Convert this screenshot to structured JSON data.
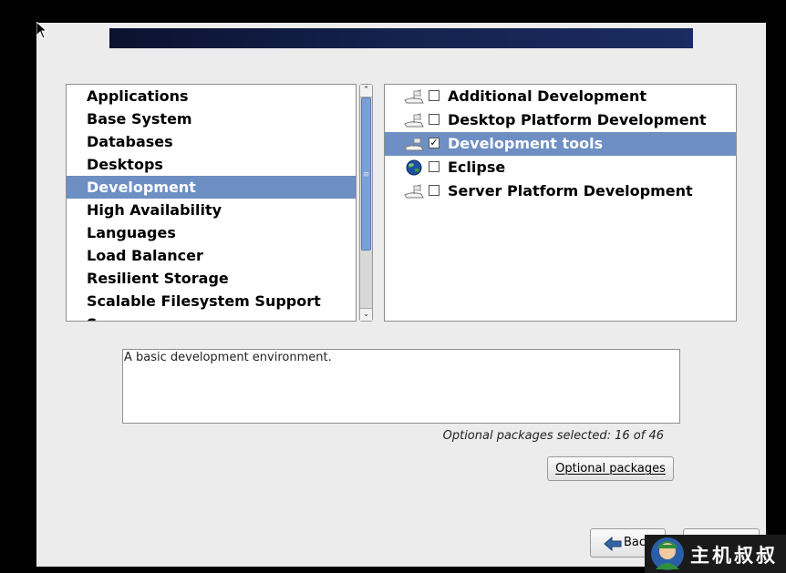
{
  "categories": {
    "items": [
      {
        "label": "Applications",
        "selected": false
      },
      {
        "label": "Base System",
        "selected": false
      },
      {
        "label": "Databases",
        "selected": false
      },
      {
        "label": "Desktops",
        "selected": false
      },
      {
        "label": "Development",
        "selected": true
      },
      {
        "label": "High Availability",
        "selected": false
      },
      {
        "label": "Languages",
        "selected": false
      },
      {
        "label": "Load Balancer",
        "selected": false
      },
      {
        "label": "Resilient Storage",
        "selected": false
      },
      {
        "label": "Scalable Filesystem Support",
        "selected": false
      },
      {
        "label": "Servers",
        "selected": false
      }
    ]
  },
  "groups": {
    "items": [
      {
        "label": "Additional Development",
        "icon": "package-icon",
        "checked": false,
        "selected": false
      },
      {
        "label": "Desktop Platform Development",
        "icon": "package-icon",
        "checked": false,
        "selected": false
      },
      {
        "label": "Development tools",
        "icon": "package-icon",
        "checked": true,
        "selected": true
      },
      {
        "label": "Eclipse",
        "icon": "globe-icon",
        "checked": false,
        "selected": false
      },
      {
        "label": "Server Platform Development",
        "icon": "package-icon",
        "checked": false,
        "selected": false
      }
    ]
  },
  "description": "A basic development environment.",
  "optional_status": "Optional packages selected: 16 of 46",
  "buttons": {
    "optional_packages": "Optional packages",
    "back": "Back"
  },
  "watermark": {
    "text": "主机叔叔"
  },
  "colors": {
    "selection": "#6e8fc4",
    "banner": "#14224e",
    "window_bg": "#ececec"
  }
}
